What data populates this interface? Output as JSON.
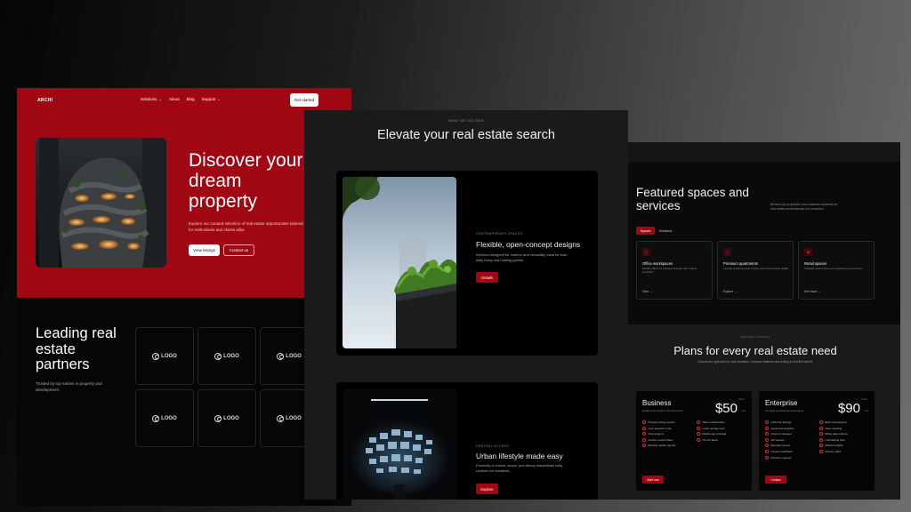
{
  "panel1": {
    "nav": {
      "logo": "ARCHI",
      "links": [
        "Solutions",
        "About",
        "Blog",
        "Support"
      ],
      "cta": "Get started"
    },
    "hero": {
      "title": "Discover your dream property",
      "subtitle": "Explore our curated selection of real estate opportunities tailored for enthusiasts and clients alike.",
      "primary_button": "View listings",
      "secondary_button": "Contact us"
    },
    "partners": {
      "title": "Leading real estate partners",
      "subtitle": "Trusted by top names in property and development.",
      "logos": [
        "LOGO",
        "LOGO",
        "LOGO",
        "LOGO",
        "LOGO",
        "LOGO"
      ]
    }
  },
  "panel2": {
    "eyebrow": "WHAT WE DELIVER",
    "title": "Elevate your real estate search",
    "card1": {
      "eyebrow": "CONTEMPORARY SPACES",
      "title": "Flexible, open-concept designs",
      "description": "Interiors designed for comfort and versatility, ideal for both daily living and hosting guests.",
      "button": "Details"
    },
    "card2": {
      "eyebrow": "CENTRAL ACCESS",
      "title": "Urban lifestyle made easy",
      "description": "Proximity to transit, shops, and dining streamlines daily routines for residents.",
      "button": "Explore"
    }
  },
  "panel3": {
    "featured": {
      "title": "Featured spaces and services",
      "subtitle": "Browse top properties and business solutions for real estate professionals and investors.",
      "tabs": [
        "Spaces",
        "Solutions"
      ],
      "cards": [
        {
          "title": "Office workspaces",
          "description": "Flexible offices for business success with modern amenities.",
          "link": "View"
        },
        {
          "title": "Premium apartments",
          "description": "Upscale residences with comfort and refined design details.",
          "link": "Explore"
        },
        {
          "title": "Retail spaces",
          "description": "Strategic retail locations for expanding your business.",
          "link": "See more"
        }
      ]
    },
    "plans": {
      "eyebrow": "PRICING OPTIONS",
      "title": "Plans for every real estate need",
      "subtitle": "Choose the right plan for your business. Compare features and pricing to find the best fit.",
      "items": [
        {
          "name": "Business",
          "description": "Designed for small to mid-size teams",
          "from": "From",
          "price": "$50",
          "unit": "/mo",
          "features_left": [
            "Property listing access",
            "Core analytics tools",
            "Chat support",
            "Custom search filters",
            "Monthly market reports"
          ],
          "features_right": [
            "Team collaboration",
            "Lead management",
            "Mobile app included",
            "Priority alerts"
          ],
          "button": "Start now"
        },
        {
          "name": "Enterprise",
          "description": "For large networks and developers",
          "from": "From",
          "price": "$90",
          "unit": "/mo",
          "features_left": [
            "Unlimited listings",
            "Advanced analytics",
            "Account manager",
            "API access",
            "Branded reports",
            "Custom workflows",
            "Premium support"
          ],
          "features_right": [
            "Bulk import/export",
            "Team tracking",
            "White-label options",
            "Onboarding help",
            "Market insights",
            "Partner offers"
          ],
          "button": "Contact"
        }
      ]
    }
  }
}
